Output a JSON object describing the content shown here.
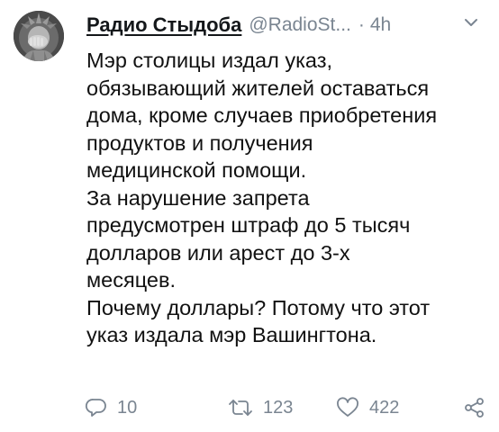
{
  "tweet": {
    "display_name": "Радио Стыдоба",
    "handle": "@RadioSt...",
    "separator": "·",
    "time": "4h",
    "text_lines": [
      "Мэр столицы издал указ,",
      "обязывающий жителей оставаться",
      "дома, кроме случаев приобретения",
      "продуктов и получения",
      "медицинской помощи.",
      "За нарушение запрета",
      "предусмотрен штраф до 5 тысяч",
      "долларов или арест до 3-х",
      "месяцев.",
      "Почему доллары? Потому что этот",
      "указ издала мэр Вашингтона."
    ]
  },
  "actions": {
    "replies": "10",
    "retweets": "123",
    "likes": "422"
  },
  "icons": {
    "avatar": "statue-of-liberty-facepalm-avatar",
    "menu": "chevron-down-icon",
    "reply": "reply-icon",
    "retweet": "retweet-icon",
    "like": "heart-icon",
    "share": "share-icon"
  },
  "colors": {
    "text": "#111111",
    "secondary": "#7a8591",
    "background": "#ffffff"
  }
}
